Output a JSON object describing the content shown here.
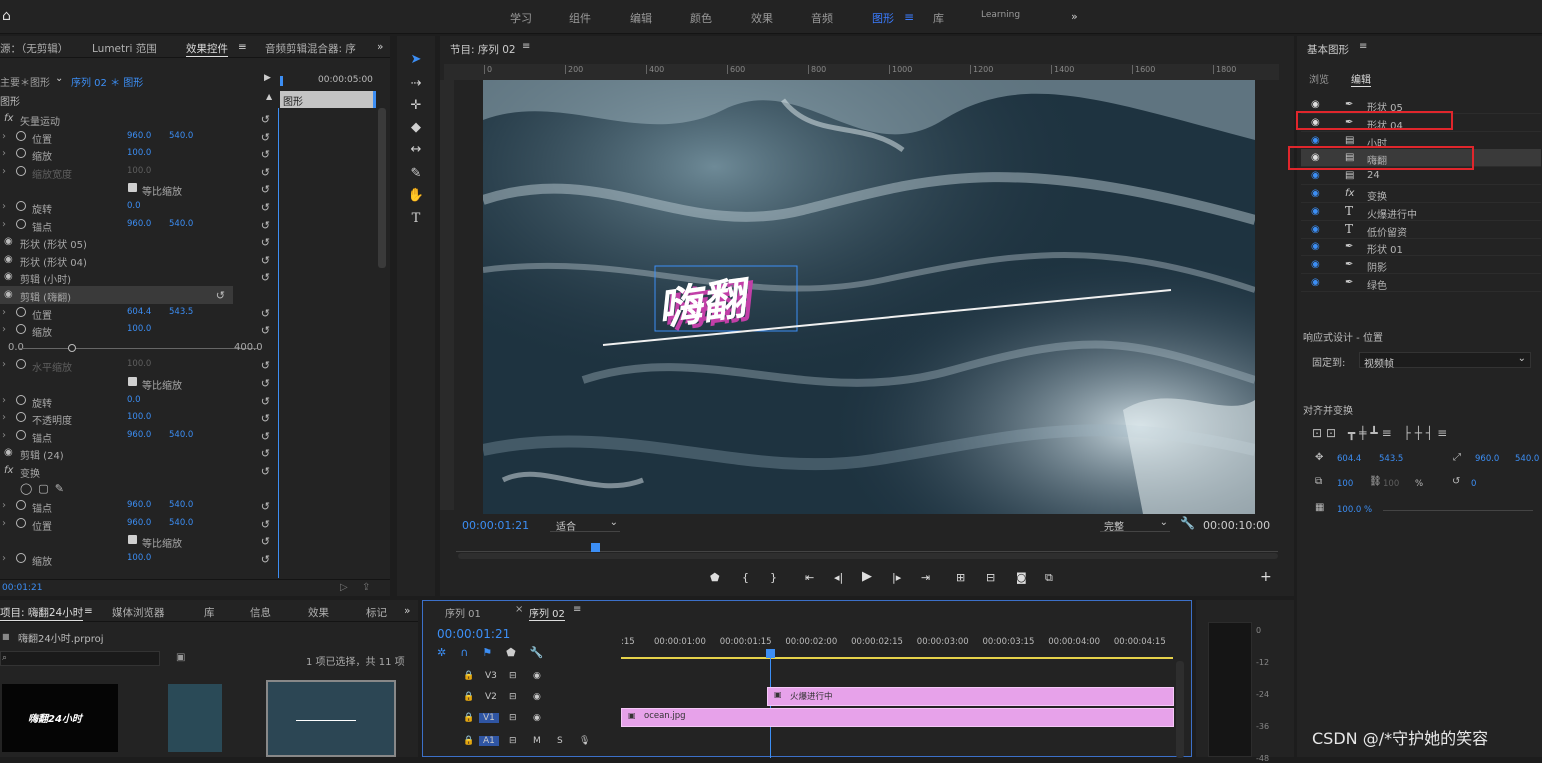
{
  "topbar": {
    "workspaces": [
      "学习",
      "组件",
      "编辑",
      "颜色",
      "效果",
      "音频",
      "图形",
      "库",
      "Learning"
    ],
    "active": "图形",
    "more": "»"
  },
  "effect_controls": {
    "tabs": [
      "源：（无剪辑）",
      "Lumetri 范围",
      "效果控件",
      "音频剪辑混合器: 序"
    ],
    "active_tab": "效果控件",
    "breadcrumb_left": "主要＊图形",
    "breadcrumb_seq": "序列 02 ＊ 图形",
    "mini_timecode": "00:00:05:00",
    "clip_label": "图形",
    "section": "图形",
    "rows": [
      {
        "label": "矢量运动",
        "type": "fx"
      },
      {
        "label": "位置",
        "v1": "960.0",
        "v2": "540.0"
      },
      {
        "label": "缩放",
        "v1": "100.0"
      },
      {
        "label": "缩放宽度",
        "v1": "100.0",
        "dim": true
      },
      {
        "label": "等比缩放",
        "type": "check"
      },
      {
        "label": "旋转",
        "v1": "0.0"
      },
      {
        "label": "锚点",
        "v1": "960.0",
        "v2": "540.0"
      },
      {
        "label": "形状 (形状 05)",
        "type": "layer"
      },
      {
        "label": "形状 (形状 04)",
        "type": "layer"
      },
      {
        "label": "剪辑 (小时)",
        "type": "layer"
      },
      {
        "label": "剪辑 (嗨翻)",
        "type": "layer",
        "selected": true
      },
      {
        "label": "位置",
        "v1": "604.4",
        "v2": "543.5"
      },
      {
        "label": "缩放",
        "v1": "100.0"
      },
      {
        "label": "slider",
        "type": "slider",
        "min": "0.0",
        "max": "400.0"
      },
      {
        "label": "水平缩放",
        "v1": "100.0",
        "dim": true
      },
      {
        "label": "等比缩放",
        "type": "check"
      },
      {
        "label": "旋转",
        "v1": "0.0"
      },
      {
        "label": "不透明度",
        "v1": "100.0"
      },
      {
        "label": "锚点",
        "v1": "960.0",
        "v2": "540.0"
      },
      {
        "label": "剪辑 (24)",
        "type": "layer"
      },
      {
        "label": "变换",
        "type": "fx"
      },
      {
        "label": "shapes",
        "type": "shapes"
      },
      {
        "label": "锚点",
        "v1": "960.0",
        "v2": "540.0"
      },
      {
        "label": "位置",
        "v1": "960.0",
        "v2": "540.0"
      },
      {
        "label": "等比缩放",
        "type": "check"
      },
      {
        "label": "缩放",
        "v1": "100.0"
      }
    ],
    "footer_timecode": "00:01:21"
  },
  "program": {
    "title": "节目: 序列 02",
    "ruler_ticks": [
      "0",
      "200",
      "400",
      "600",
      "800",
      "1000",
      "1200",
      "1400",
      "1600",
      "1800"
    ],
    "overlay_text": "嗨翻",
    "timecode": "00:00:01:21",
    "fit": "适合",
    "quality": "完整",
    "duration": "00:00:10:00"
  },
  "essential_graphics": {
    "title": "基本图形",
    "tabs": [
      "浏览",
      "编辑"
    ],
    "active_tab": "编辑",
    "layers": [
      {
        "name": "形状 05",
        "icon": "pen"
      },
      {
        "name": "形状 04",
        "icon": "pen"
      },
      {
        "name": "小时",
        "icon": "clip"
      },
      {
        "name": "嗨翻",
        "icon": "clip"
      },
      {
        "name": "24",
        "icon": "clip"
      },
      {
        "name": "变换",
        "icon": "fx"
      },
      {
        "name": "火爆进行中",
        "icon": "text"
      },
      {
        "name": "低价留资",
        "icon": "text"
      },
      {
        "name": "形状 01",
        "icon": "pen"
      },
      {
        "name": "阴影",
        "icon": "pen"
      },
      {
        "name": "绿色",
        "icon": "pen"
      }
    ],
    "responsive_title": "响应式设计 - 位置",
    "pin_label": "固定到:",
    "pin_value": "视频帧",
    "align_title": "对齐并变换",
    "pos_x": "604.4",
    "pos_y": "543.5",
    "anchor_x": "960.0",
    "anchor_y": "540.0",
    "scale": "100",
    "scale2": "100",
    "percent": "%",
    "rotation": "0",
    "opacity": "100.0 %"
  },
  "project": {
    "tabs": [
      "项目: 嗨翻24小时",
      "媒体浏览器",
      "库",
      "信息",
      "效果",
      "标记"
    ],
    "file": "嗨翻24小时.prproj",
    "selection": "1 项已选择，共 11 项",
    "thumb_text": "嗨翻24小时"
  },
  "timeline": {
    "tabs": [
      "序列 01",
      "序列 02"
    ],
    "active_tab": "序列 02",
    "timecode": "00:00:01:21",
    "ruler": [
      ":15",
      "00:00:01:00",
      "00:00:01:15",
      "00:00:02:00",
      "00:00:02:15",
      "00:00:03:00",
      "00:00:03:15",
      "00:00:04:00",
      "00:00:04:15"
    ],
    "tracks": [
      "V3",
      "V2",
      "V1",
      "A1"
    ],
    "clip_v2": "火爆进行中",
    "clip_v1": "ocean.jpg"
  },
  "meter": {
    "scale": [
      "0",
      "-12",
      "-24",
      "-36",
      "-48"
    ]
  },
  "watermark": "CSDN @/*守护她的笑容"
}
